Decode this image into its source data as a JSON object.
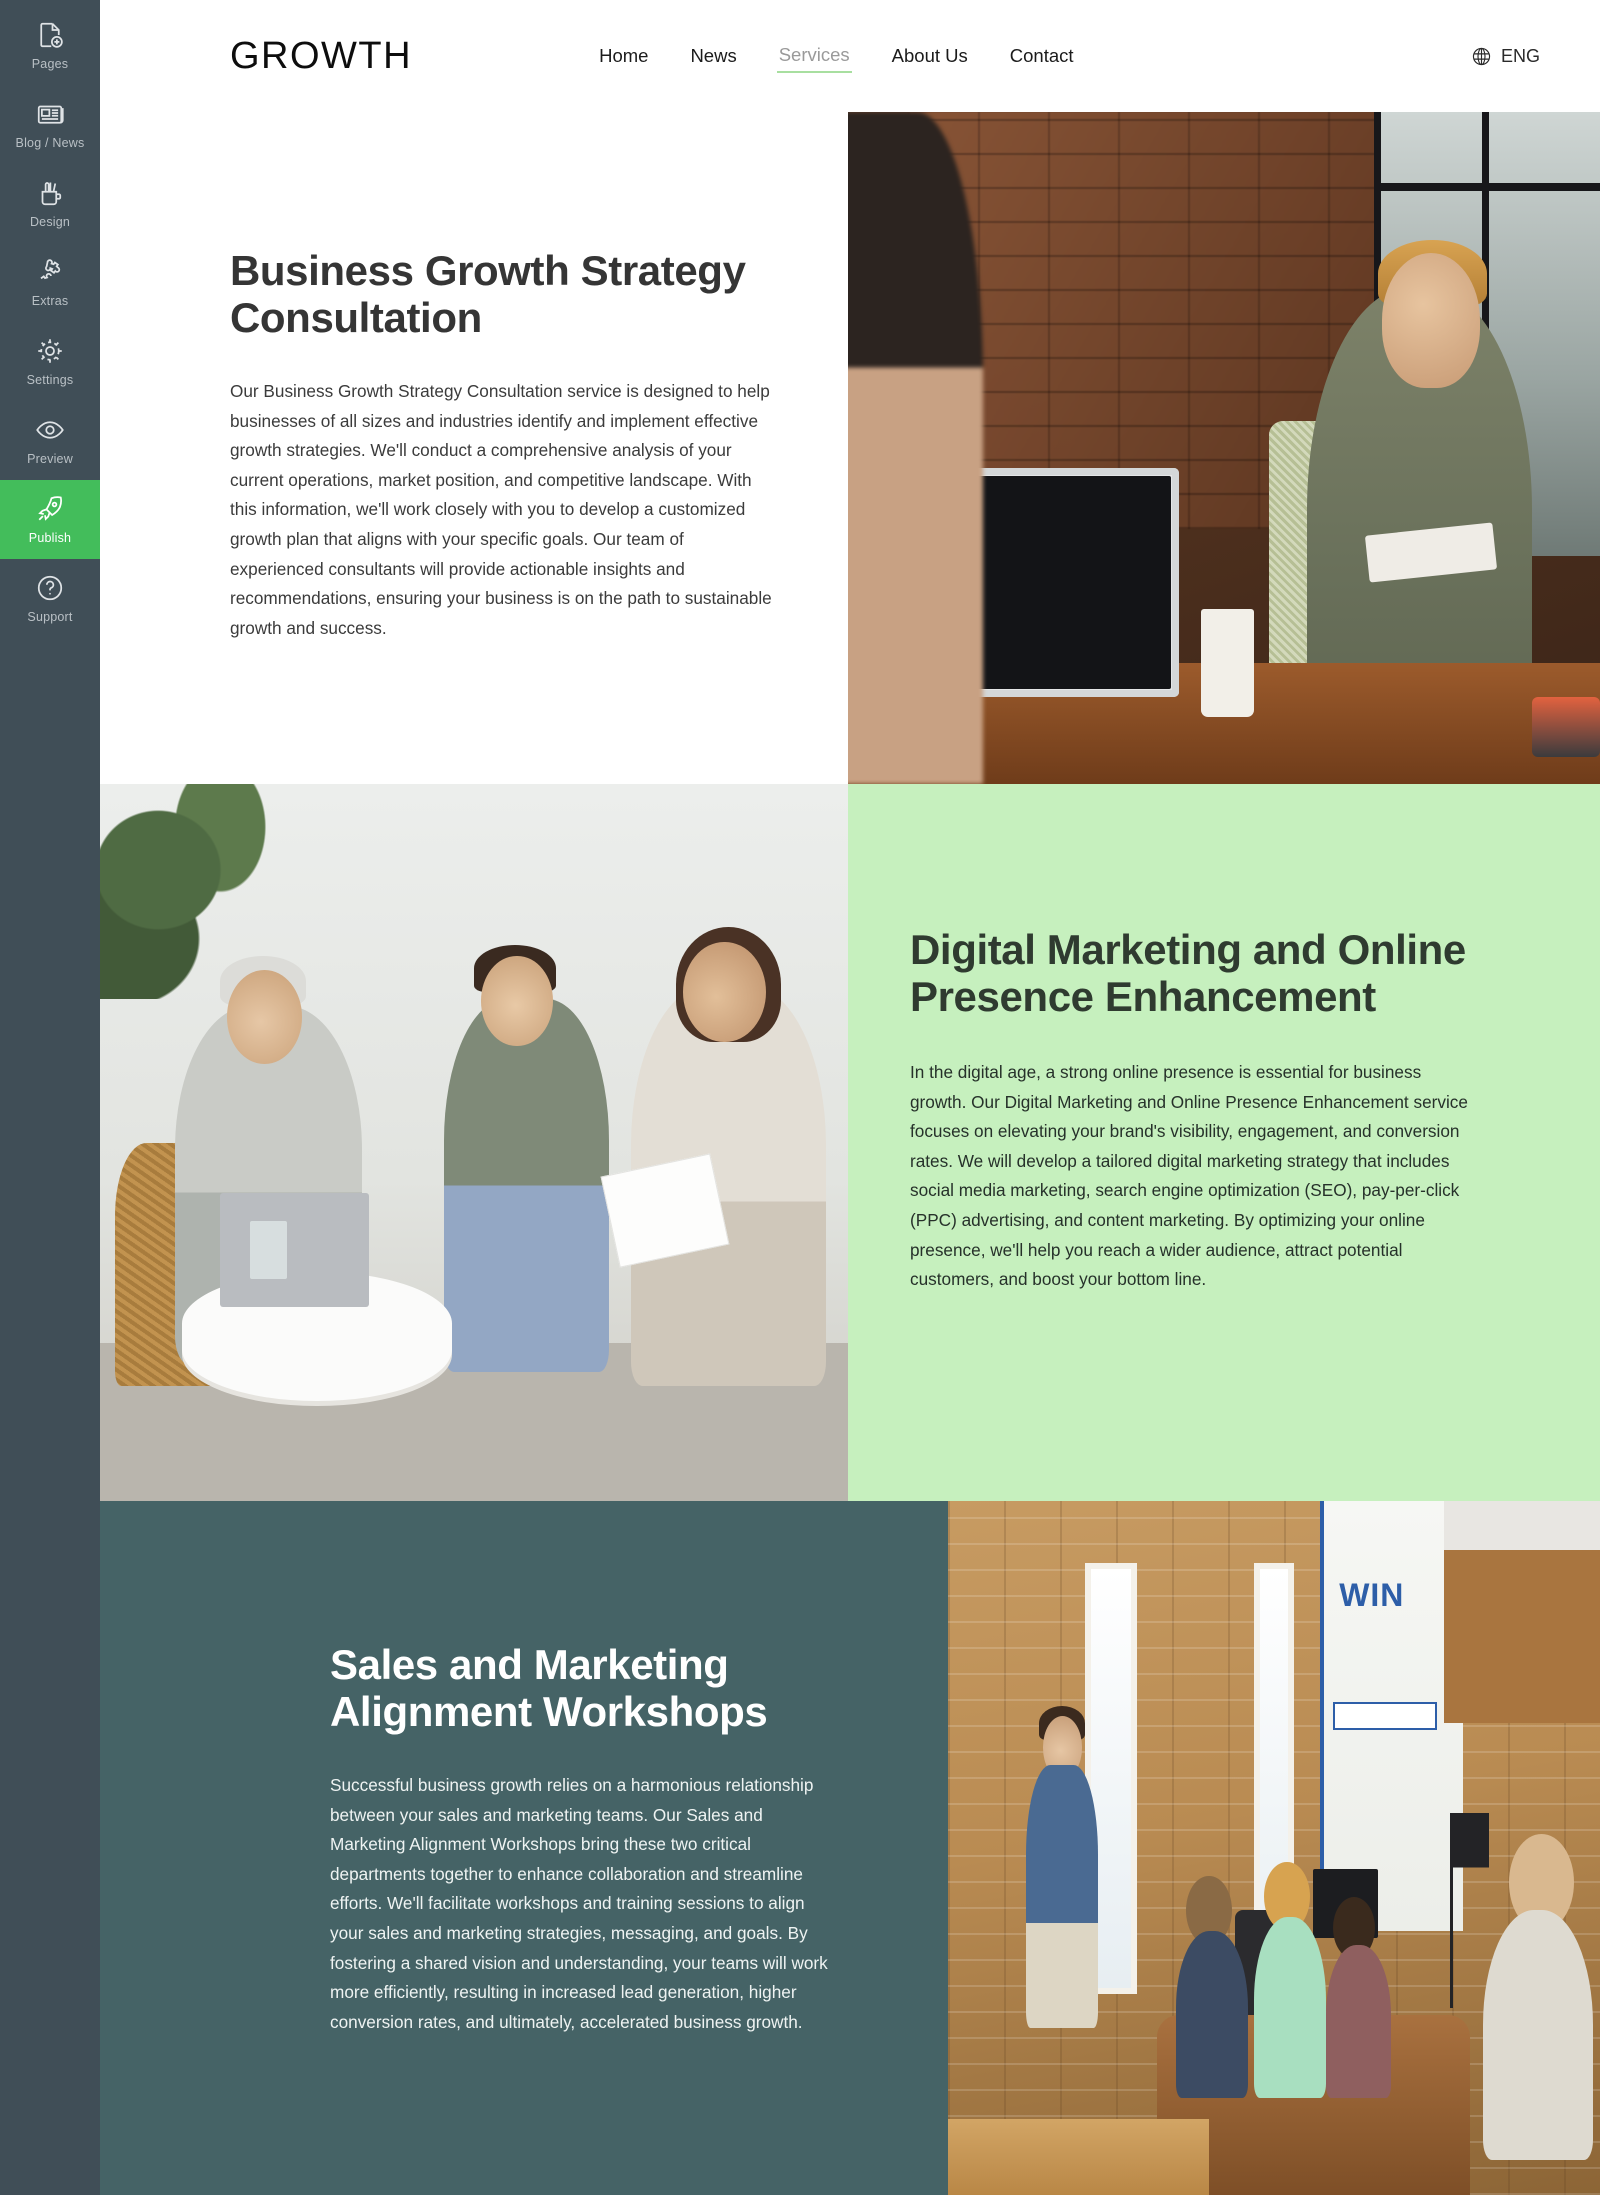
{
  "sidebar": {
    "items": [
      {
        "label": "Pages",
        "icon": "page-add-icon",
        "active": false
      },
      {
        "label": "Blog / News",
        "icon": "newspaper-icon",
        "active": false
      },
      {
        "label": "Design",
        "icon": "design-cup-icon",
        "active": false
      },
      {
        "label": "Extras",
        "icon": "puzzle-icon",
        "active": false
      },
      {
        "label": "Settings",
        "icon": "gear-icon",
        "active": false
      },
      {
        "label": "Preview",
        "icon": "eye-icon",
        "active": false
      },
      {
        "label": "Publish",
        "icon": "rocket-icon",
        "active": true
      },
      {
        "label": "Support",
        "icon": "question-icon",
        "active": false
      }
    ],
    "active_color": "#43bd5b",
    "background_color": "#404e57"
  },
  "header": {
    "brand": "GROWTH",
    "nav": [
      {
        "label": "Home",
        "current": false
      },
      {
        "label": "News",
        "current": false
      },
      {
        "label": "Services",
        "current": true
      },
      {
        "label": "About Us",
        "current": false
      },
      {
        "label": "Contact",
        "current": false
      }
    ],
    "language": {
      "icon": "globe-icon",
      "label": "ENG"
    },
    "underline_color": "#a8dfa0"
  },
  "sections": [
    {
      "id": "business-growth-strategy-consultation",
      "title": "Business Growth Strategy Consultation",
      "body": "Our Business Growth Strategy Consultation service is designed to help businesses of all sizes and industries identify and implement effective growth strategies. We'll conduct a comprehensive analysis of your current operations, market position, and competitive landscape. With this information, we'll work closely with you to develop a customized growth plan that aligns with your specific goals. Our team of experienced consultants will provide actionable insights and recommendations, ensuring your business is on the path to sustainable growth and success.",
      "background_color": "#ffffff",
      "text_color": "#353535",
      "image_alt": "consultant-meeting-photo",
      "image_side": "right"
    },
    {
      "id": "digital-marketing-and-online-presence-enhancement",
      "title": "Digital Marketing and Online Presence Enhancement",
      "body": "In the digital age, a strong online presence is essential for business growth. Our Digital Marketing and Online Presence Enhancement service focuses on elevating your brand's visibility, engagement, and conversion rates. We will develop a tailored digital marketing strategy that includes social media marketing, search engine optimization (SEO), pay-per-click (PPC) advertising, and content marketing. By optimizing your online presence, we'll help you reach a wider audience, attract potential customers, and boost your bottom line.",
      "background_color": "#c6f0be",
      "text_color": "#2f3b30",
      "image_alt": "team-discussion-photo",
      "image_side": "left"
    },
    {
      "id": "sales-and-marketing-alignment-workshops",
      "title": "Sales and Marketing Alignment Workshops",
      "body": "Successful business growth relies on a harmonious relationship between your sales and marketing teams. Our Sales and Marketing Alignment Workshops bring these two critical departments together to enhance collaboration and streamline efforts. We'll facilitate workshops and training sessions to align your sales and marketing strategies, messaging, and goals. By fostering a shared vision and understanding, your teams will work more efficiently, resulting in increased lead generation, higher conversion rates, and ultimately, accelerated business growth.",
      "background_color": "#456366",
      "text_color": "#ffffff",
      "image_alt": "workshop-presentation-photo",
      "image_side": "right"
    }
  ],
  "photo3_labels": {
    "win": "WIN"
  }
}
